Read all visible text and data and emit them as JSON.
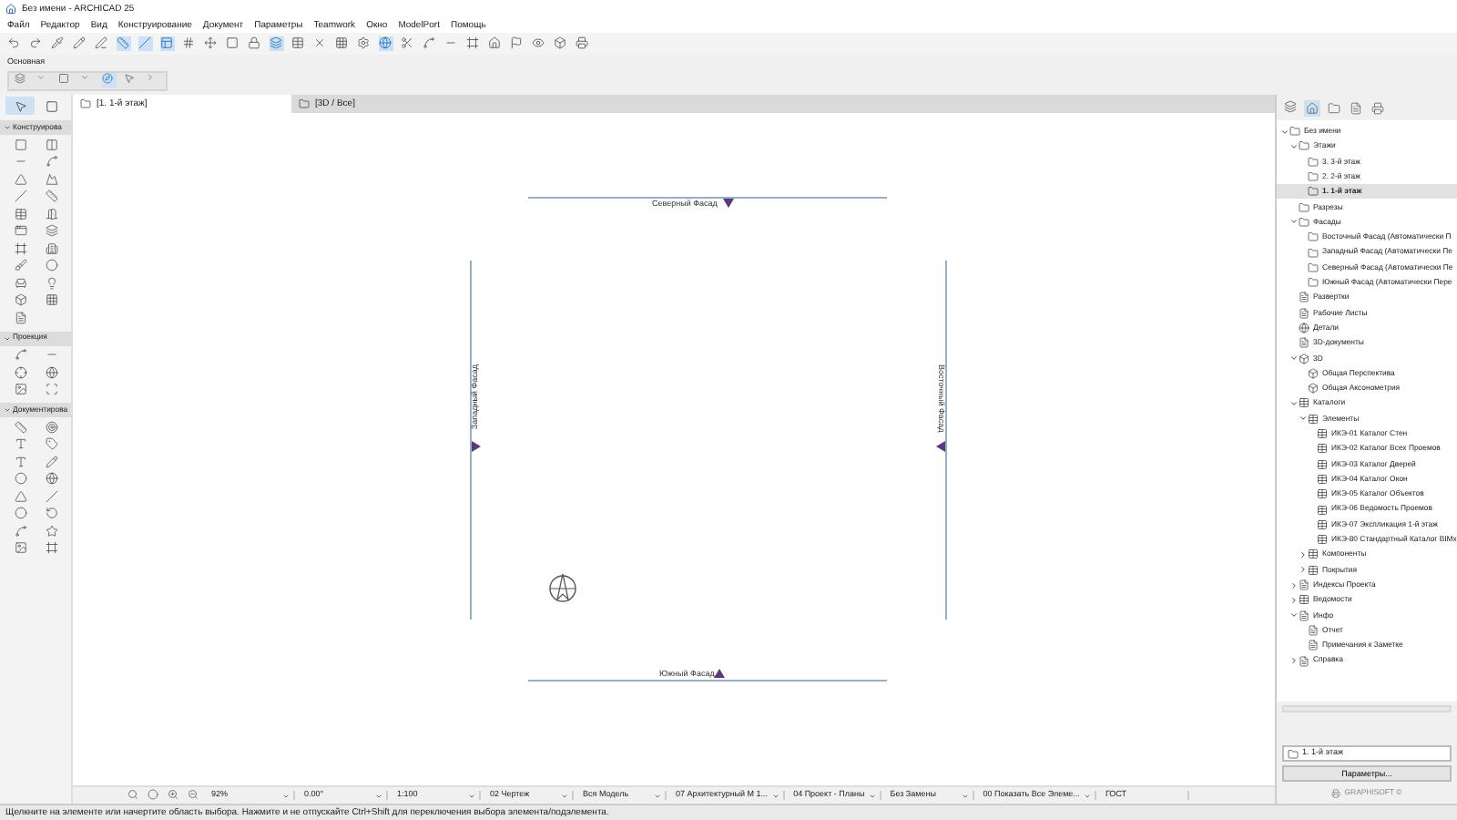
{
  "window": {
    "title": "Без имени - ARCHICAD 25"
  },
  "menu": [
    "Файл",
    "Редактор",
    "Вид",
    "Конструирование",
    "Документ",
    "Параметры",
    "Teamwork",
    "Окно",
    "ModelPort",
    "Помощь"
  ],
  "palette": {
    "title": "Основная"
  },
  "toolbox": {
    "top_tools": [
      {
        "selected": true
      },
      {
        "selected": false
      }
    ],
    "sections": [
      {
        "title": "Конструирова",
        "expanded": true
      },
      {
        "title": "Проекция",
        "expanded": true
      },
      {
        "title": "Документирова",
        "expanded": true
      }
    ]
  },
  "tabs": [
    {
      "label": "[1. 1-й этаж]",
      "selected": true
    },
    {
      "label": "[3D / Все]",
      "selected": false
    }
  ],
  "canvas": {
    "elevations": [
      {
        "kind": "top",
        "label": "Северный Фасад"
      },
      {
        "kind": "left",
        "label": "Западный Фасад"
      },
      {
        "kind": "right",
        "label": "Восточный Фасад"
      },
      {
        "kind": "bottom",
        "label": "Южный Фасад"
      }
    ]
  },
  "bottom_bar": [
    {
      "value": "92%",
      "dropdown": true
    },
    {
      "value": "0.00°",
      "dropdown": true
    },
    {
      "value": "1:100",
      "dropdown": true
    },
    {
      "value": "02 Чертеж",
      "dropdown": true
    },
    {
      "value": "Вся Модель",
      "dropdown": true
    },
    {
      "value": "07 Архитектурный М 1...",
      "dropdown": true
    },
    {
      "value": "04 Проект - Планы",
      "dropdown": true
    },
    {
      "value": "Без Замены",
      "dropdown": true
    },
    {
      "value": "00 Показать Все Элеме...",
      "dropdown": true
    },
    {
      "value": "ГОСТ",
      "dropdown": false
    }
  ],
  "navigator": {
    "modes": [
      {
        "selected": true
      },
      {
        "selected": false
      },
      {
        "selected": false
      },
      {
        "selected": false
      }
    ],
    "tree": [
      {
        "label": "Без имени",
        "kind": "folder",
        "expanded": true,
        "selected": false,
        "children": [
          {
            "label": "Этажи",
            "kind": "folder",
            "expanded": true,
            "selected": false,
            "children": [
              {
                "label": "3. 3-й этаж",
                "kind": "folder",
                "selected": false
              },
              {
                "label": "2. 2-й этаж",
                "kind": "folder",
                "selected": false
              },
              {
                "label": "1. 1-й этаж",
                "kind": "folder",
                "selected": true
              }
            ]
          },
          {
            "label": "Разрезы",
            "kind": "folder",
            "selected": false
          },
          {
            "label": "Фасады",
            "kind": "folder",
            "expanded": true,
            "selected": false,
            "children": [
              {
                "label": "Восточный Фасад (Автоматически П",
                "kind": "folder",
                "selected": false
              },
              {
                "label": "Западный Фасад (Автоматически Пе",
                "kind": "folder",
                "selected": false
              },
              {
                "label": "Северный Фасад (Автоматически Пе",
                "kind": "folder",
                "selected": false
              },
              {
                "label": "Южный Фасад (Автоматически Пере",
                "kind": "folder",
                "selected": false
              }
            ]
          },
          {
            "label": "Развертки",
            "kind": "sheet",
            "selected": false
          },
          {
            "label": "Рабочие Листы",
            "kind": "sheet",
            "selected": false
          },
          {
            "label": "Детали",
            "kind": "globe",
            "selected": false
          },
          {
            "label": "3D-документы",
            "kind": "sheet",
            "selected": false
          },
          {
            "label": "3D",
            "kind": "cube",
            "expanded": true,
            "selected": false,
            "children": [
              {
                "label": "Общая Перспектива",
                "kind": "cube",
                "selected": false
              },
              {
                "label": "Общая Аксонометрия",
                "kind": "cube",
                "selected": false
              }
            ]
          },
          {
            "label": "Каталоги",
            "kind": "table",
            "expanded": true,
            "selected": false,
            "children": [
              {
                "label": "Элементы",
                "kind": "table",
                "expanded": true,
                "selected": false,
                "children": [
                  {
                    "label": "ИКЭ-01 Каталог Стен",
                    "kind": "table",
                    "selected": false
                  },
                  {
                    "label": "ИКЭ-02 Каталог Всех Проемов",
                    "kind": "table",
                    "selected": false
                  },
                  {
                    "label": "ИКЭ-03 Каталог Дверей",
                    "kind": "table",
                    "selected": false
                  },
                  {
                    "label": "ИКЭ-04 Каталог Окон",
                    "kind": "table",
                    "selected": false
                  },
                  {
                    "label": "ИКЭ-05 Каталог Объектов",
                    "kind": "table",
                    "selected": false
                  },
                  {
                    "label": "ИКЭ-06 Ведомость Проемов",
                    "kind": "table",
                    "selected": false
                  },
                  {
                    "label": "ИКЭ-07 Экспликация 1-й этаж",
                    "kind": "table",
                    "selected": false
                  },
                  {
                    "label": "ИКЭ-80 Стандартный Каталог BIMx",
                    "kind": "table",
                    "selected": false
                  }
                ]
              },
              {
                "label": "Компоненты",
                "kind": "table",
                "expanded": false,
                "selected": false
              },
              {
                "label": "Покрытия",
                "kind": "table",
                "expanded": false,
                "selected": false
              }
            ]
          },
          {
            "label": "Индексы Проекта",
            "kind": "sheet",
            "expanded": false,
            "selected": false
          },
          {
            "label": "Ведомости",
            "kind": "table",
            "expanded": false,
            "selected": false
          },
          {
            "label": "Инфо",
            "kind": "sheet",
            "expanded": true,
            "selected": false,
            "children": [
              {
                "label": "Отчет",
                "kind": "doc",
                "selected": false
              },
              {
                "label": "Примечания к Заметке",
                "kind": "doc",
                "selected": false
              }
            ]
          },
          {
            "label": "Справка",
            "kind": "sheet",
            "expanded": false,
            "selected": false
          }
        ]
      }
    ],
    "current_view": "1. 1-й этаж",
    "settings_button": "Параметры...",
    "brand": "GRAPHISOFT ©"
  },
  "status_bar": "Щелкните на элементе или начертите область выбора. Нажмите и не отпускайте Ctrl+Shift для переключения выбора элемента/подэлемента."
}
